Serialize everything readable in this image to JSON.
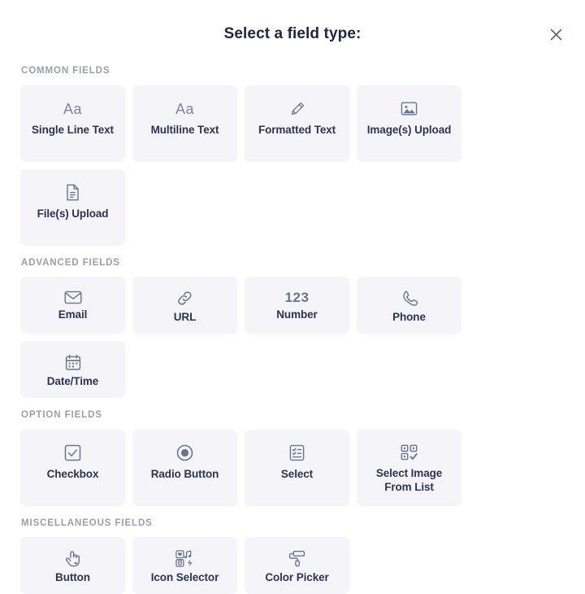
{
  "dialog": {
    "title": "Select a field type:",
    "close_label": "×",
    "close_icon": "close-icon"
  },
  "sections": [
    {
      "id": "common-fields",
      "heading": "COMMON FIELDS",
      "row_height": "tall",
      "cards": [
        {
          "id": "single-line-text",
          "label": "Single Line Text",
          "icon": "text-aa-icon",
          "icon_kind": "text",
          "icon_text": "Aa"
        },
        {
          "id": "multiline-text",
          "label": "Multiline Text",
          "icon": "text-aa-icon",
          "icon_kind": "text",
          "icon_text": "Aa"
        },
        {
          "id": "formatted-text",
          "label": "Formatted Text",
          "icon": "pencil-icon",
          "icon_kind": "svg"
        },
        {
          "id": "images-upload",
          "label": "Image(s) Upload",
          "icon": "image-icon",
          "icon_kind": "svg"
        },
        {
          "id": "files-upload",
          "label": "File(s) Upload",
          "icon": "document-icon",
          "icon_kind": "svg"
        }
      ]
    },
    {
      "id": "advanced-fields",
      "heading": "ADVANCED FIELDS",
      "row_height": "short",
      "cards": [
        {
          "id": "email",
          "label": "Email",
          "icon": "envelope-icon",
          "icon_kind": "svg"
        },
        {
          "id": "url",
          "label": "URL",
          "icon": "link-icon",
          "icon_kind": "svg"
        },
        {
          "id": "number",
          "label": "Number",
          "icon": "numbers-123-icon",
          "icon_kind": "text",
          "icon_text": "123"
        },
        {
          "id": "phone",
          "label": "Phone",
          "icon": "phone-icon",
          "icon_kind": "svg"
        },
        {
          "id": "date-time",
          "label": "Date/Time",
          "icon": "calendar-icon",
          "icon_kind": "svg"
        }
      ]
    },
    {
      "id": "option-fields",
      "heading": "OPTION FIELDS",
      "row_height": "tall",
      "cards": [
        {
          "id": "checkbox",
          "label": "Checkbox",
          "icon": "checkbox-checked-icon",
          "icon_kind": "svg"
        },
        {
          "id": "radio-button",
          "label": "Radio Button",
          "icon": "radio-filled-icon",
          "icon_kind": "svg"
        },
        {
          "id": "select",
          "label": "Select",
          "icon": "list-checklist-icon",
          "icon_kind": "svg"
        },
        {
          "id": "select-image-from-list",
          "label": "Select Image From List",
          "icon": "grid-select-icon",
          "icon_kind": "svg"
        }
      ]
    },
    {
      "id": "miscellaneous-fields",
      "heading": "MISCELLANEOUS FIELDS",
      "row_height": "short",
      "cards": [
        {
          "id": "button",
          "label": "Button",
          "icon": "pointing-hand-icon",
          "icon_kind": "svg"
        },
        {
          "id": "icon-selector",
          "label": "Icon Selector",
          "icon": "icon-grid-icon",
          "icon_kind": "svg"
        },
        {
          "id": "color-picker",
          "label": "Color Picker",
          "icon": "paint-roller-icon",
          "icon_kind": "svg"
        }
      ]
    }
  ],
  "colors": {
    "card_background": "#f4f4f9",
    "label_text": "#2c3453",
    "heading_text": "#9c9cb2",
    "icon": "#6a7490",
    "title_text": "#1f2544",
    "page_background": "#ffffff"
  }
}
